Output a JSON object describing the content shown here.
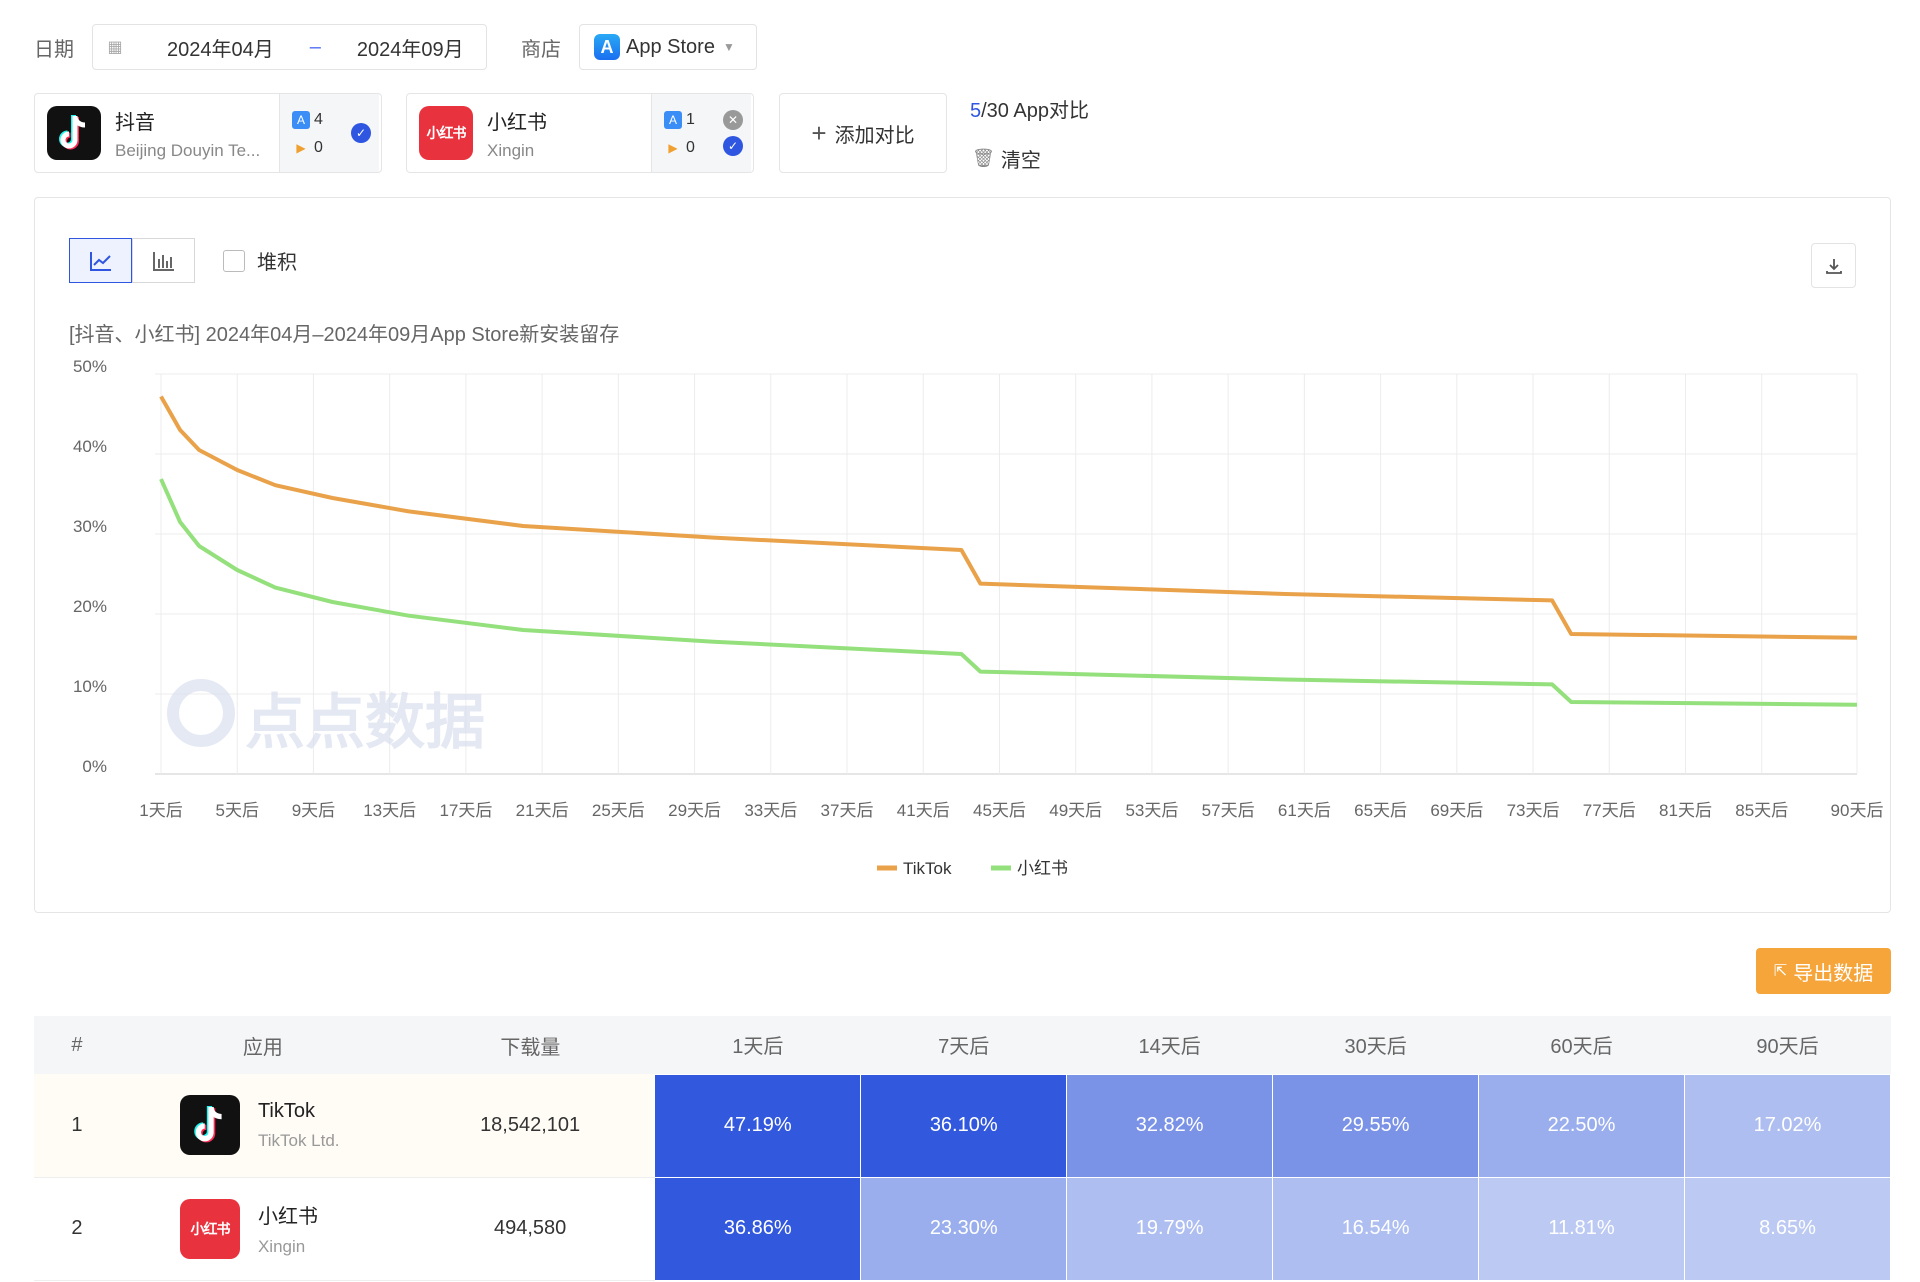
{
  "filters": {
    "date_label": "日期",
    "date_start": "2024年04月",
    "date_end": "2024年09月",
    "date_sep": "–",
    "store_label": "商店",
    "store_value": "App Store"
  },
  "apps": [
    {
      "name": "抖音",
      "developer": "Beijing Douyin Te...",
      "appstore_count": "4",
      "gp_count": "0"
    },
    {
      "name": "小红书",
      "developer": "Xingin",
      "appstore_count": "1",
      "gp_count": "0"
    }
  ],
  "add_compare": "添加对比",
  "compare_count_current": "5",
  "compare_count_total": "/30 App对比",
  "clear_label": "清空",
  "stack_label": "堆积",
  "chart_title": "[抖音、小红书] 2024年04月–2024年09月App Store新安装留存",
  "chart_data": {
    "type": "line",
    "x_labels": [
      "1天后",
      "5天后",
      "9天后",
      "13天后",
      "17天后",
      "21天后",
      "25天后",
      "29天后",
      "33天后",
      "37天后",
      "41天后",
      "45天后",
      "49天后",
      "53天后",
      "57天后",
      "61天后",
      "65天后",
      "69天后",
      "73天后",
      "77天后",
      "81天后",
      "85天后",
      "90天后"
    ],
    "ylim": [
      0,
      50
    ],
    "y_ticks": [
      "0%",
      "10%",
      "20%",
      "30%",
      "40%",
      "50%"
    ],
    "legend_position": "bottom",
    "series": [
      {
        "name": "TikTok",
        "color": "#e9a24a",
        "points": [
          [
            1,
            47.19
          ],
          [
            2,
            43.0
          ],
          [
            3,
            40.5
          ],
          [
            5,
            38.0
          ],
          [
            7,
            36.1
          ],
          [
            10,
            34.5
          ],
          [
            14,
            32.82
          ],
          [
            20,
            31.0
          ],
          [
            30,
            29.55
          ],
          [
            43,
            28.0
          ],
          [
            44,
            23.8
          ],
          [
            60,
            22.5
          ],
          [
            74,
            21.7
          ],
          [
            75,
            17.5
          ],
          [
            90,
            17.02
          ]
        ]
      },
      {
        "name": "小红书",
        "color": "#94e07c",
        "points": [
          [
            1,
            36.86
          ],
          [
            2,
            31.5
          ],
          [
            3,
            28.5
          ],
          [
            5,
            25.5
          ],
          [
            7,
            23.3
          ],
          [
            10,
            21.5
          ],
          [
            14,
            19.79
          ],
          [
            20,
            18.0
          ],
          [
            30,
            16.54
          ],
          [
            43,
            15.0
          ],
          [
            44,
            12.8
          ],
          [
            60,
            11.81
          ],
          [
            74,
            11.2
          ],
          [
            75,
            9.0
          ],
          [
            90,
            8.65
          ]
        ]
      }
    ]
  },
  "watermark": "点点数据",
  "export_label": "导出数据",
  "table": {
    "headers": [
      "#",
      "应用",
      "下载量",
      "1天后",
      "7天后",
      "14天后",
      "30天后",
      "60天后",
      "90天后"
    ],
    "rows": [
      {
        "rank": "1",
        "name": "TikTok",
        "developer": "TikTok Ltd.",
        "downloads": "18,542,101",
        "values": [
          "47.19%",
          "36.10%",
          "32.82%",
          "29.55%",
          "22.50%",
          "17.02%"
        ]
      },
      {
        "rank": "2",
        "name": "小红书",
        "developer": "Xingin",
        "downloads": "494,580",
        "values": [
          "36.86%",
          "23.30%",
          "19.79%",
          "16.54%",
          "11.81%",
          "8.65%"
        ]
      }
    ]
  }
}
